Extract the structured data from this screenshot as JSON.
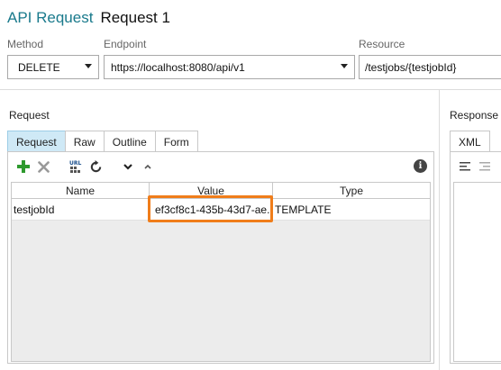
{
  "header": {
    "title": "API Request",
    "subtitle": "Request 1"
  },
  "fields": {
    "method_label": "Method",
    "method_value": "DELETE",
    "endpoint_label": "Endpoint",
    "endpoint_value": "https://localhost:8080/api/v1",
    "resource_label": "Resource",
    "resource_value": "/testjobs/{testjobId}"
  },
  "request": {
    "section_label": "Request",
    "tabs": [
      {
        "label": "Request",
        "active": true
      },
      {
        "label": "Raw",
        "active": false
      },
      {
        "label": "Outline",
        "active": false
      },
      {
        "label": "Form",
        "active": false
      }
    ],
    "toolbar": {
      "icons": [
        "add-icon",
        "delete-icon",
        "url-encode-icon",
        "refresh-icon",
        "move-down-icon",
        "move-up-icon",
        "info-icon"
      ]
    },
    "table": {
      "columns": [
        "Name",
        "Value",
        "Type"
      ],
      "rows": [
        {
          "name": "testjobId",
          "value": "ef3cf8c1-435b-43d7-ae...",
          "type": "TEMPLATE"
        }
      ]
    }
  },
  "response": {
    "section_label": "Response",
    "tabs": [
      {
        "label": "XML"
      }
    ]
  },
  "colors": {
    "accent": "#1a7a8c",
    "active_tab": "#cfe9f6",
    "highlight": "#f07d1a",
    "add_green": "#2e9a2e"
  }
}
